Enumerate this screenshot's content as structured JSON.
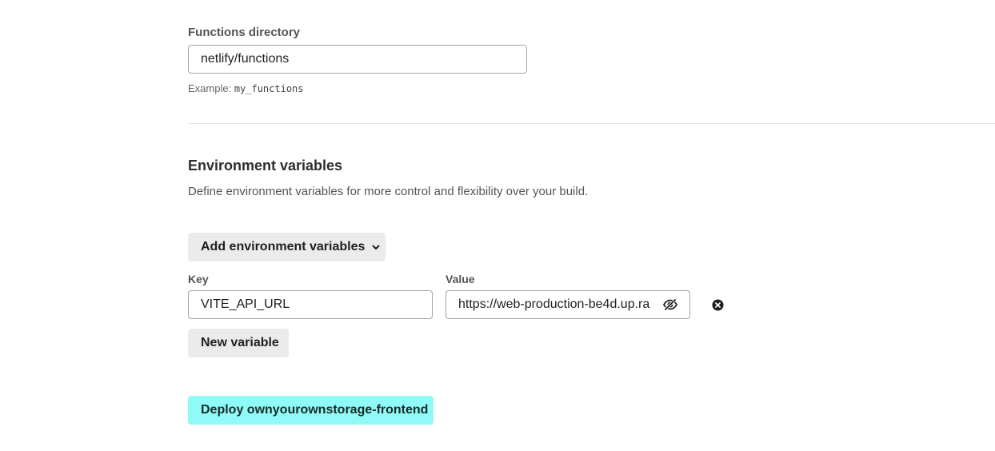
{
  "functions": {
    "label": "Functions directory",
    "value": "netlify/functions",
    "hint_prefix": "Example: ",
    "hint_code": "my_functions"
  },
  "env": {
    "heading": "Environment variables",
    "description": "Define environment variables for more control and flexibility over your build.",
    "add_button_label": "Add environment variables",
    "key_label": "Key",
    "value_label": "Value",
    "key_value": "VITE_API_URL",
    "value_value": "https://web-production-be4d.up.ra",
    "new_variable_label": "New variable"
  },
  "deploy": {
    "label": "Deploy ownyourownstorage-frontend"
  },
  "colors": {
    "deploy_bg": "#8ffaf6",
    "secondary_button_bg": "#ebebeb",
    "input_border": "#a3a3a3"
  }
}
